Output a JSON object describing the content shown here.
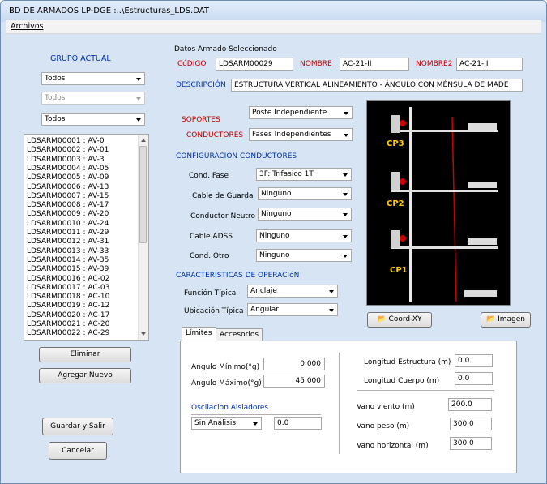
{
  "window": {
    "title": "BD DE ARMADOS LP-DGE :..\\Estructuras_LDS.DAT"
  },
  "menu": {
    "archivos": "Archivos"
  },
  "left": {
    "grupo_actual": "GRUPO ACTUAL",
    "combo1": "Todos",
    "combo2": "Todos",
    "combo3": "Todos",
    "list": [
      "LDSARM00001 : AV-0",
      "LDSARM00002 : AV-01",
      "LDSARM00003 : AV-3",
      "LDSARM00004 : AV-05",
      "LDSARM00005 : AV-09",
      "LDSARM00006 : AV-13",
      "LDSARM00007 : AV-15",
      "LDSARM00008 : AV-17",
      "LDSARM00009 : AV-20",
      "LDSARM00010 : AV-24",
      "LDSARM00011 : AV-29",
      "LDSARM00012 : AV-31",
      "LDSARM00013 : AV-33",
      "LDSARM00014 : AV-35",
      "LDSARM00015 : AV-39",
      "LDSARM00016 : AC-02",
      "LDSARM00017 : AC-03",
      "LDSARM00018 : AC-10",
      "LDSARM00019 : AC-12",
      "LDSARM00020 : AC-17",
      "LDSARM00021 : AC-20",
      "LDSARM00022 : AC-29"
    ],
    "eliminar": "Eliminar",
    "agregar": "Agregar Nuevo",
    "guardar": "Guardar y Salir",
    "cancelar": "Cancelar"
  },
  "datos": {
    "header": "Datos Armado Seleccionado",
    "codigo_label": "CóDIGO",
    "codigo_value": "LDSARM00029",
    "nombre_label": "NOMBRE",
    "nombre_value": "AC-21-II",
    "nombre2_label": "NOMBRE2",
    "nombre2_value": "AC-21-II",
    "descripcion_label": "DESCRIPCIÓN",
    "descripcion_value": "ESTRUCTURA VERTICAL ALINEAMIENTO - ÁNGULO CON MÉNSULA DE MADE"
  },
  "soportes": {
    "label": "SOPORTES",
    "value": "Poste Independiente"
  },
  "conductores": {
    "label": "CONDUCTORES",
    "value": "Fases Independientes"
  },
  "config": {
    "header": "CONFIGURACION CONDUCTORES",
    "cond_fase_label": "Cond. Fase",
    "cond_fase_value": "3F: Trifasico 1T",
    "cable_guarda_label": "Cable de Guarda",
    "cable_guarda_value": "Ninguno",
    "neutro_label": "Conductor Neutro",
    "neutro_value": "Ninguno",
    "adss_label": "Cable ADSS",
    "adss_value": "Ninguno",
    "otro_label": "Cond. Otro",
    "otro_value": "Ninguno"
  },
  "operacion": {
    "header": "CARACTERISTICAS DE OPERACIóN",
    "funcion_label": "Función Típica",
    "funcion_value": "Anclaje",
    "ubicacion_label": "Ubicación Típica",
    "ubicacion_value": "Angular"
  },
  "preview": {
    "cp3": "CP3",
    "cp2": "CP2",
    "cp1": "CP1"
  },
  "buttons": {
    "coord": "Coord-XY",
    "imagen": "Imagen"
  },
  "tabs": {
    "limites": "Límites",
    "accesorios": "Accesorios",
    "angulo_min_label": "Angulo Mínimo(°g)",
    "angulo_min_value": "0.000",
    "angulo_max_label": "Angulo Máximo(°g)",
    "angulo_max_value": "45.000",
    "oscilacion_label": "Oscilacion Aisladores",
    "oscilacion_value": "Sin Análisis",
    "oscilacion_num": "0.0",
    "long_estructura_label": "Longitud Estructura (m)",
    "long_estructura_value": "0.0",
    "long_cuerpo_label": "Longitud Cuerpo (m)",
    "long_cuerpo_value": "0.0",
    "vano_viento_label": "Vano viento (m)",
    "vano_viento_value": "200.0",
    "vano_peso_label": "Vano peso (m)",
    "vano_peso_value": "300.0",
    "vano_horizontal_label": "Vano horizontal (m)",
    "vano_horizontal_value": "300.0"
  }
}
